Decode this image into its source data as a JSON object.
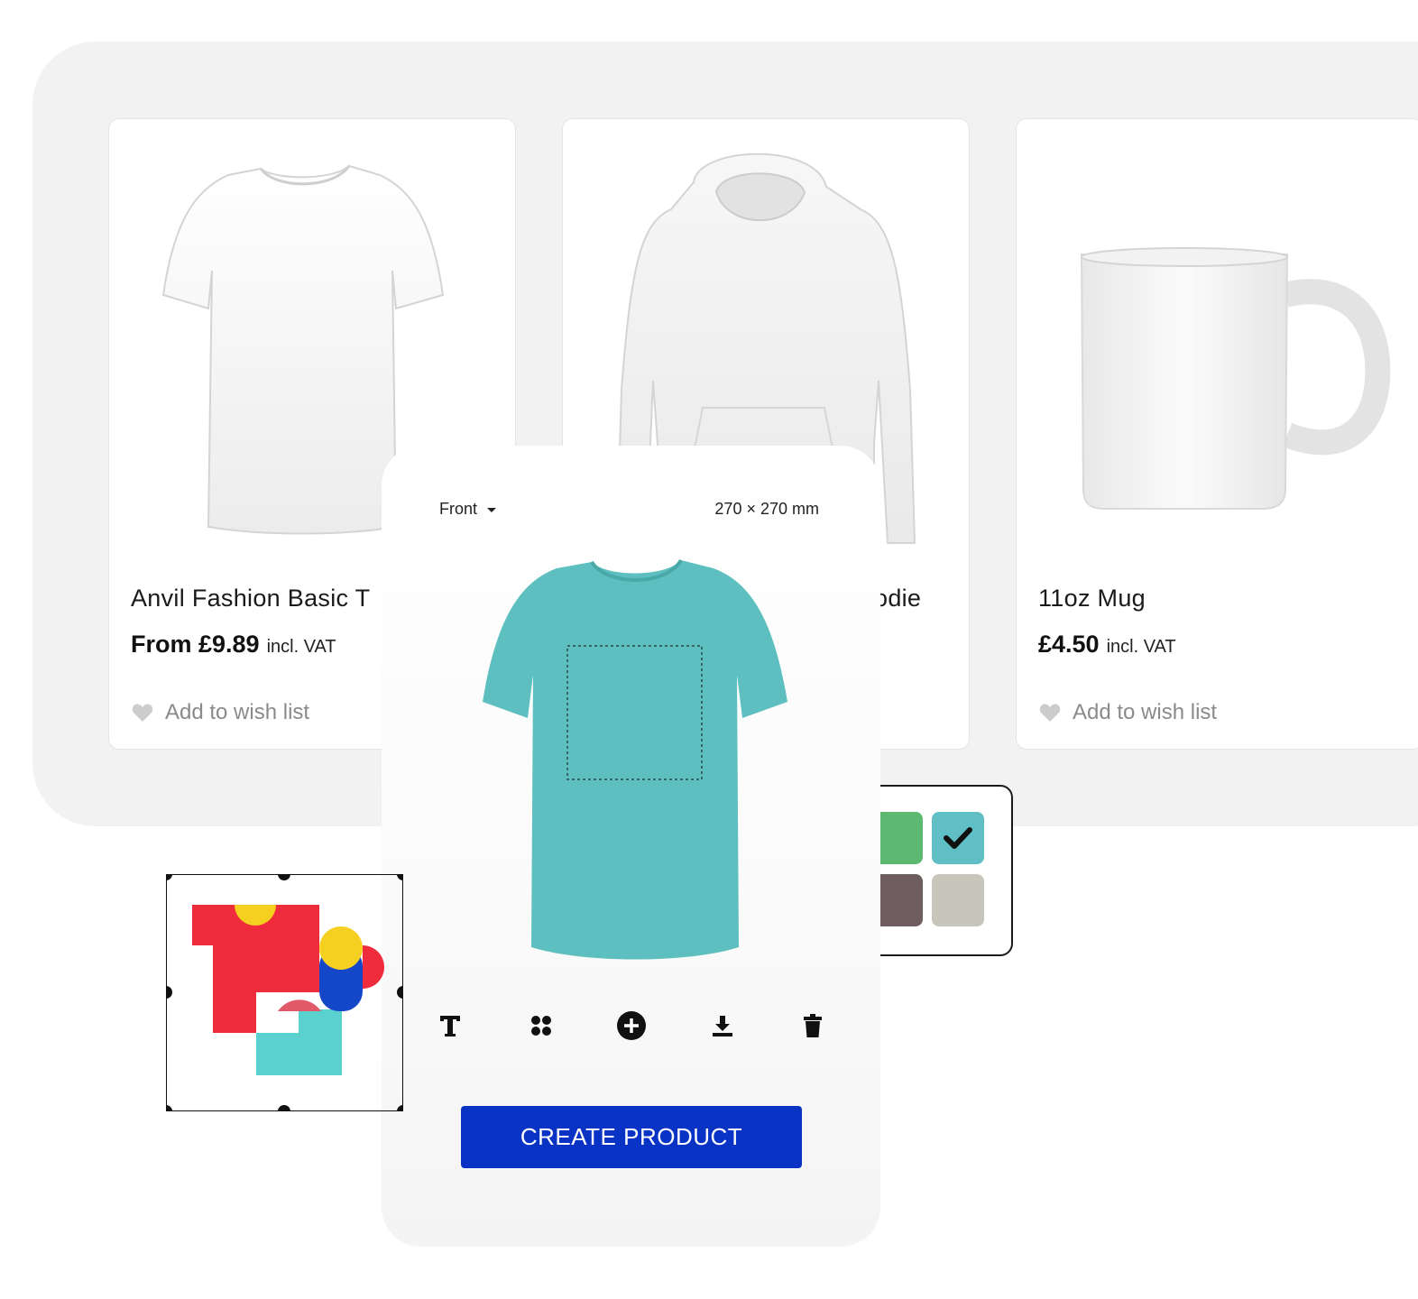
{
  "products": [
    {
      "title": "Anvil Fashion Basic T",
      "price": "From £9.89",
      "vat": "incl. VAT",
      "wish": "Add to wish list"
    },
    {
      "title": "odie",
      "price": "",
      "vat": "",
      "wish": ""
    },
    {
      "title": "11oz Mug",
      "price": "£4.50",
      "vat": "incl. VAT",
      "wish": "Add to wish list"
    }
  ],
  "editor": {
    "side": "Front",
    "dimensions": "270 × 270 mm",
    "shirt_color": "#5dbfbf",
    "tools": [
      "text-icon",
      "layout-icon",
      "add-icon",
      "download-icon",
      "trash-icon"
    ],
    "cta": "CREATE PRODUCT",
    "cta_color": "#0933c5"
  },
  "swatches": [
    {
      "color": "#5db871",
      "selected": false
    },
    {
      "color": "#5fbfc4",
      "selected": true
    },
    {
      "color": "#6e5e5f",
      "selected": false
    },
    {
      "color": "#c8c5bb",
      "selected": false
    }
  ]
}
